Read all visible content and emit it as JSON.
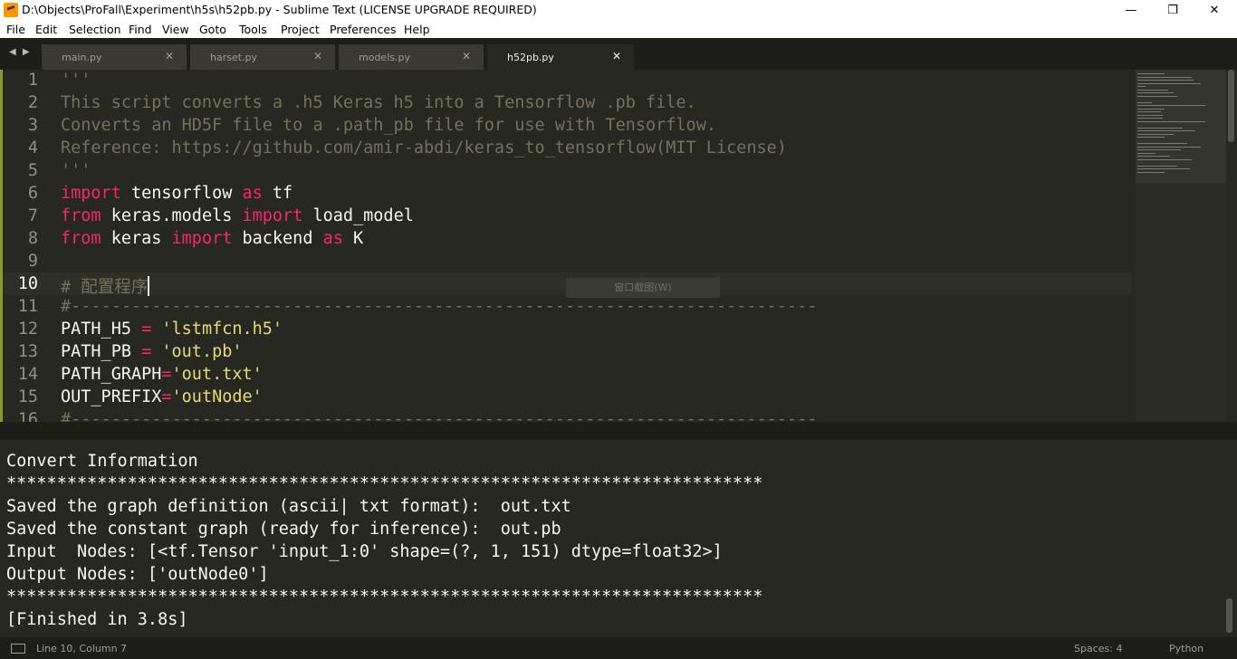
{
  "window": {
    "title": "D:\\Objects\\ProFall\\Experiment\\h5s\\h52pb.py - Sublime Text (LICENSE UPGRADE REQUIRED)",
    "minimize_glyph": "—",
    "maximize_glyph": "❐",
    "close_glyph": "✕"
  },
  "menu": [
    "File",
    "Edit",
    "Selection",
    "Find",
    "View",
    "Goto",
    "Tools",
    "Project",
    "Preferences",
    "Help"
  ],
  "tabs": {
    "nav_glyph": "◀ ▶",
    "items": [
      {
        "label": "main.py",
        "close": "✕"
      },
      {
        "label": "harset.py",
        "close": "✕"
      },
      {
        "label": "models.py",
        "close": "✕"
      },
      {
        "label": "h52pb.py",
        "close": "✕",
        "active": true
      }
    ]
  },
  "editor": {
    "current_line": 10,
    "lines": [
      {
        "n": "1",
        "tokens": [
          {
            "t": "'''",
            "c": "comment"
          }
        ]
      },
      {
        "n": "2",
        "tokens": [
          {
            "t": "This script converts a .h5 Keras h5 into a Tensorflow .pb file.",
            "c": "comment"
          }
        ]
      },
      {
        "n": "3",
        "tokens": [
          {
            "t": "Converts an HD5F file to a .path_pb file for use with Tensorflow.",
            "c": "comment"
          }
        ]
      },
      {
        "n": "4",
        "tokens": [
          {
            "t": "Reference: https://github.com/amir-abdi/keras_to_tensorflow(MIT License)",
            "c": "comment"
          }
        ]
      },
      {
        "n": "5",
        "tokens": [
          {
            "t": "'''",
            "c": "comment"
          }
        ]
      },
      {
        "n": "6",
        "tokens": [
          {
            "t": "import",
            "c": "kw"
          },
          {
            "t": " tensorflow ",
            "c": "plain"
          },
          {
            "t": "as",
            "c": "kw"
          },
          {
            "t": " tf",
            "c": "plain"
          }
        ]
      },
      {
        "n": "7",
        "tokens": [
          {
            "t": "from",
            "c": "kw"
          },
          {
            "t": " keras.models ",
            "c": "plain"
          },
          {
            "t": "import",
            "c": "kw"
          },
          {
            "t": " load_model",
            "c": "plain"
          }
        ]
      },
      {
        "n": "8",
        "tokens": [
          {
            "t": "from",
            "c": "kw"
          },
          {
            "t": " keras ",
            "c": "plain"
          },
          {
            "t": "import",
            "c": "kw"
          },
          {
            "t": " backend ",
            "c": "plain"
          },
          {
            "t": "as",
            "c": "kw"
          },
          {
            "t": " K",
            "c": "plain"
          }
        ]
      },
      {
        "n": "9",
        "tokens": []
      },
      {
        "n": "10",
        "tokens": [
          {
            "t": "# 配置程序",
            "c": "comment"
          }
        ],
        "cursor": true
      },
      {
        "n": "11",
        "tokens": [
          {
            "t": "#--------------------------------------------------------------------------",
            "c": "comment"
          }
        ]
      },
      {
        "n": "12",
        "tokens": [
          {
            "t": "PATH_H5 ",
            "c": "plain"
          },
          {
            "t": "=",
            "c": "kw"
          },
          {
            "t": " ",
            "c": "plain"
          },
          {
            "t": "'lstmfcn.h5'",
            "c": "str"
          }
        ]
      },
      {
        "n": "13",
        "tokens": [
          {
            "t": "PATH_PB ",
            "c": "plain"
          },
          {
            "t": "=",
            "c": "kw"
          },
          {
            "t": " ",
            "c": "plain"
          },
          {
            "t": "'out.pb'",
            "c": "str"
          }
        ]
      },
      {
        "n": "14",
        "tokens": [
          {
            "t": "PATH_GRAPH",
            "c": "plain"
          },
          {
            "t": "=",
            "c": "kw"
          },
          {
            "t": "'out.txt'",
            "c": "str"
          }
        ]
      },
      {
        "n": "15",
        "tokens": [
          {
            "t": "OUT_PREFIX",
            "c": "plain"
          },
          {
            "t": "=",
            "c": "kw"
          },
          {
            "t": "'outNode'",
            "c": "str"
          }
        ]
      },
      {
        "n": "16",
        "tokens": [
          {
            "t": "#--------------------------------------------------------------------------",
            "c": "comment"
          }
        ]
      }
    ],
    "overlay_tip": "窗口截图(W)"
  },
  "output": {
    "lines": [
      "Convert Information",
      "***************************************************************************",
      "Saved the graph definition (ascii| txt format):  out.txt",
      "Saved the constant graph (ready for inference):  out.pb",
      "Input  Nodes: [<tf.Tensor 'input_1:0' shape=(?, 1, 151) dtype=float32>]",
      "Output Nodes: ['outNode0']",
      "***************************************************************************",
      "[Finished in 3.8s]"
    ]
  },
  "status": {
    "position": "Line 10, Column 7",
    "spaces": "Spaces: 4",
    "syntax": "Python"
  },
  "colors": {
    "background": "#272822",
    "keyword": "#f92672",
    "string": "#e6db74",
    "comment": "#75715e",
    "text": "#f8f8f2"
  }
}
